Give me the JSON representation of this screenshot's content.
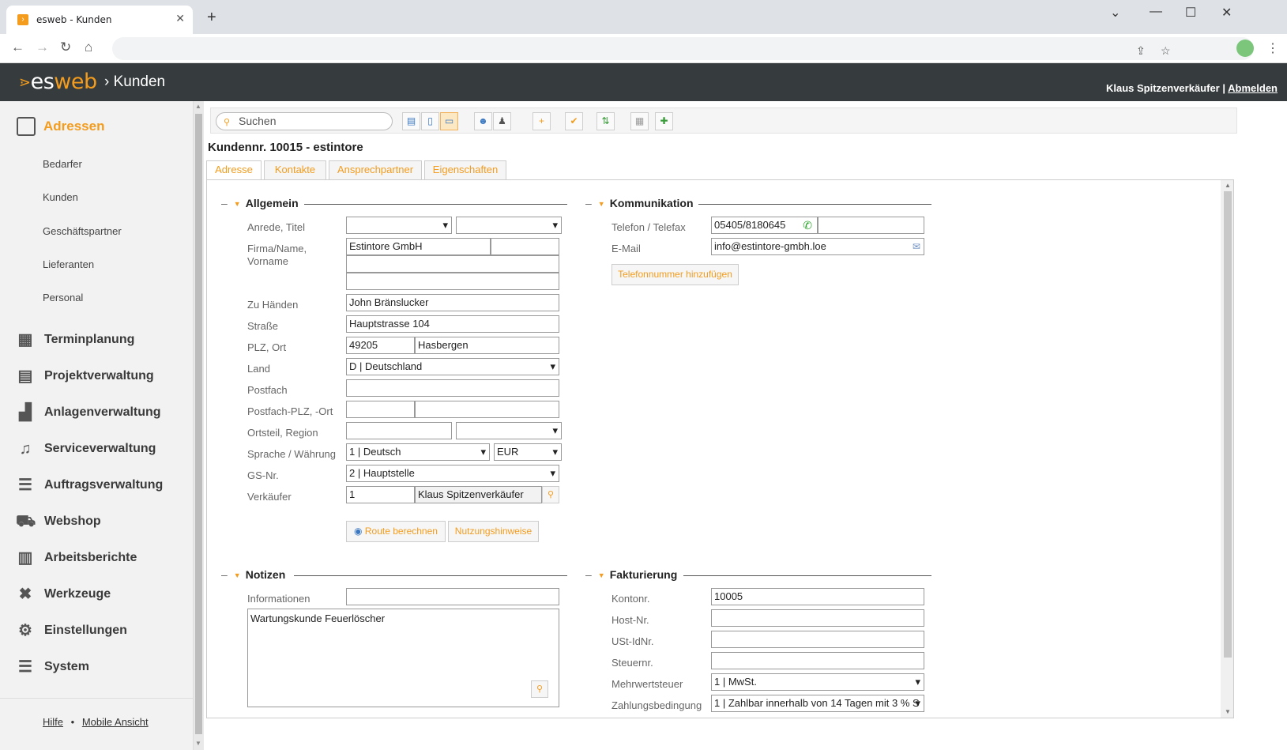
{
  "browser": {
    "tab_title": "esweb - Kunden",
    "tab_favicon": "esweb-favicon",
    "new_tab": "+",
    "close_tab": "✕"
  },
  "header": {
    "logo_es": "es",
    "logo_web": "web",
    "crumb": "Kunden",
    "user_name": "Klaus Spitzenverkäufer",
    "separator": "|",
    "logout": "Abmelden"
  },
  "sidebar": {
    "active_section": "Adressen",
    "sub_items": [
      "Bedarfer",
      "Kunden",
      "Geschäftspartner",
      "Lieferanten",
      "Personal"
    ],
    "sections": [
      {
        "label": "Terminplanung",
        "icon": "calendar-icon"
      },
      {
        "label": "Projektverwaltung",
        "icon": "project-icon"
      },
      {
        "label": "Anlagenverwaltung",
        "icon": "factory-icon"
      },
      {
        "label": "Serviceverwaltung",
        "icon": "headset-icon"
      },
      {
        "label": "Auftragsverwaltung",
        "icon": "list-icon"
      },
      {
        "label": "Webshop",
        "icon": "cart-icon"
      },
      {
        "label": "Arbeitsberichte",
        "icon": "clipboard-icon"
      },
      {
        "label": "Werkzeuge",
        "icon": "tools-icon"
      },
      {
        "label": "Einstellungen",
        "icon": "gears-icon"
      },
      {
        "label": "System",
        "icon": "database-icon"
      }
    ],
    "footer_help": "Hilfe",
    "footer_sep": "•",
    "footer_mobile": "Mobile Ansicht"
  },
  "search": {
    "placeholder": "Suchen"
  },
  "page": {
    "title": "Kundennr. 10015 - estintore"
  },
  "tabs": [
    "Adresse",
    "Kontakte",
    "Ansprechpartner",
    "Eigenschaften"
  ],
  "allgemein": {
    "title": "Allgemein",
    "labels": {
      "anrede": "Anrede, Titel",
      "firma": "Firma/Name,",
      "vorname": "Vorname",
      "zuhaenden": "Zu Händen",
      "strasse": "Straße",
      "plz": "PLZ, Ort",
      "land": "Land",
      "postfach": "Postfach",
      "postfach_plz": "Postfach-PLZ, -Ort",
      "ortsteil": "Ortsteil, Region",
      "sprache": "Sprache / Währung",
      "gsnr": "GS-Nr.",
      "verkaeufer": "Verkäufer"
    },
    "values": {
      "anrede": "",
      "titel": "",
      "firma": "Estintore GmbH",
      "firma2": "",
      "name2": "",
      "name3": "",
      "zuhaenden": "John Bränslucker",
      "strasse": "Hauptstrasse 104",
      "plz": "49205",
      "ort": "Hasbergen",
      "land": "D | Deutschland",
      "postfach": "",
      "postfach_plz": "",
      "postfach_ort": "",
      "ortsteil": "",
      "region": "",
      "sprache": "1 | Deutsch",
      "waehrung": "EUR",
      "gsnr": "2 | Hauptstelle",
      "verkaeufer_nr": "1",
      "verkaeufer_name": "Klaus Spitzenverkäufer"
    },
    "route_button": "Route berechnen",
    "nutzung_button": "Nutzungshinweise"
  },
  "kommunikation": {
    "title": "Kommunikation",
    "labels": {
      "telefon": "Telefon / Telefax",
      "email": "E-Mail"
    },
    "values": {
      "telefon": "05405/8180645",
      "telefax": "",
      "email": "info@estintore-gmbh.loe"
    },
    "add_phone_button": "Telefonnummer hinzufügen"
  },
  "notizen": {
    "title": "Notizen",
    "label_info": "Informationen",
    "info": "",
    "text": "Wartungskunde Feuerlöscher"
  },
  "fakturierung": {
    "title": "Fakturierung",
    "labels": {
      "konto": "Kontonr.",
      "host": "Host-Nr.",
      "ust": "USt-IdNr.",
      "steuer": "Steuernr.",
      "mwst": "Mehrwertsteuer",
      "zahlung": "Zahlungsbedingung"
    },
    "values": {
      "konto": "10005",
      "host": "",
      "ust": "",
      "steuer": "",
      "mwst": "1 | MwSt.",
      "zahlung": "1 | Zahlbar innerhalb von 14 Tagen mit 3 % S"
    }
  },
  "colors": {
    "accent": "#f39c1d",
    "header_bg": "#363b3d"
  }
}
